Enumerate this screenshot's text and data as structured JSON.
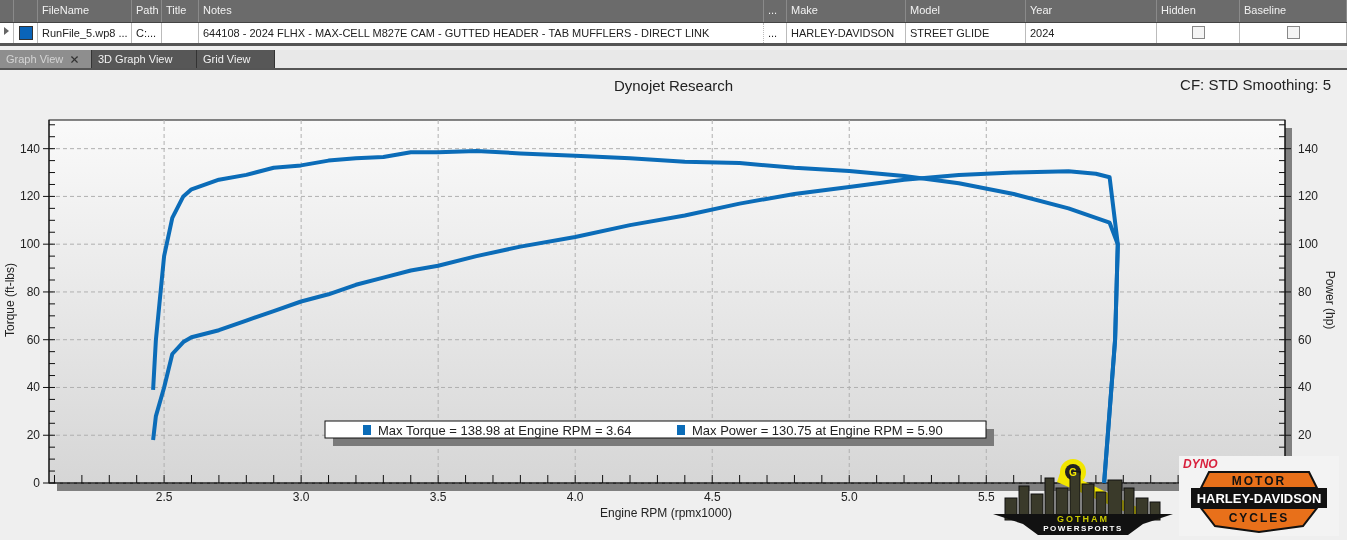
{
  "table": {
    "columns": [
      "FileName",
      "Path",
      "Title",
      "Notes",
      "...",
      "Make",
      "Model",
      "Year",
      "Hidden",
      "Baseline"
    ],
    "rows": [
      {
        "color": "#0a64b8",
        "file_name": "RunFile_5.wp8 ...",
        "path": "C:...",
        "notes": "644108 - 2024 FLHX - MAX-CELL M827E CAM - GUTTED HEADER - TAB MUFFLERS - DIRECT LINK",
        "more": "...",
        "make": "HARLEY-DAVIDSON",
        "model": "STREET GLIDE",
        "year": "2024",
        "hidden": false,
        "baseline": false
      }
    ]
  },
  "tabs": [
    {
      "label": "Graph View",
      "selected": true
    },
    {
      "label": "3D Graph View",
      "selected": false
    },
    {
      "label": "Grid View",
      "selected": false
    }
  ],
  "chart": {
    "title": "Dynojet Research",
    "settings": "CF: STD Smoothing: 5",
    "ylabel_right": "Power (hp)",
    "right_yticks": [
      "140",
      "120",
      "100",
      "80",
      "60",
      "40",
      "20"
    ],
    "legend": [
      {
        "color": "#0b6cb8",
        "text": "Max Torque = 138.98 at Engine RPM = 3.64"
      },
      {
        "color": "#0b6cb8",
        "text": "Max Power = 130.75 at Engine RPM = 5.90"
      }
    ],
    "chart_data": {
      "type": "line",
      "xlabel": "Engine RPM (rpmx1000)",
      "ylabel": "Torque (ft-lbs)",
      "xlim": [
        2.08,
        6.59
      ],
      "ylim": [
        0,
        152
      ],
      "grid": true,
      "xticks": [
        {
          "value": 2.5,
          "label": "2.5"
        },
        {
          "value": 3,
          "label": "3.0"
        },
        {
          "value": 3.5,
          "label": "3.5"
        },
        {
          "value": 4,
          "label": "4.0"
        },
        {
          "value": 4.5,
          "label": "4.5"
        },
        {
          "value": 5,
          "label": "5.0"
        },
        {
          "value": 5.5,
          "label": "5.5"
        }
      ],
      "yticks": [
        0,
        20,
        40,
        60,
        80,
        100,
        120,
        140
      ],
      "x": [
        2.46,
        2.47,
        2.5,
        2.53,
        2.57,
        2.6,
        2.7,
        2.8,
        2.9,
        3.0,
        3.1,
        3.2,
        3.3,
        3.4,
        3.5,
        3.64,
        3.8,
        4.0,
        4.2,
        4.4,
        4.6,
        4.8,
        5.0,
        5.2,
        5.4,
        5.6,
        5.8,
        5.9,
        5.95,
        5.98,
        5.97,
        5.95,
        5.93
      ],
      "series": [
        {
          "color": "#0b6cb8",
          "values": [
            39,
            60,
            95,
            111,
            120,
            123,
            127,
            129,
            132,
            133,
            135,
            136,
            136.5,
            138.5,
            138.5,
            139,
            138,
            137,
            136,
            134.5,
            134,
            132,
            130.7,
            128.5,
            125.5,
            121,
            115,
            111,
            109,
            100,
            60,
            30,
            0
          ]
        },
        {
          "color": "#0b6cb8",
          "values": [
            18,
            28,
            40,
            54,
            59,
            61,
            64,
            68,
            72,
            76,
            79,
            83,
            86,
            89,
            91,
            95,
            99,
            103,
            108,
            112,
            117,
            121,
            124,
            127,
            129,
            130,
            130.5,
            129.5,
            128,
            100,
            60,
            30,
            0
          ]
        }
      ]
    }
  },
  "logos": [
    {
      "kind": "gotham",
      "texts": [
        "G",
        "GOTHAM",
        "POWERSPORTS"
      ]
    },
    {
      "kind": "harley",
      "texts": [
        "DYNO",
        "MOTOR",
        "HARLEY-DAVIDSON",
        "CYCLES"
      ]
    }
  ]
}
